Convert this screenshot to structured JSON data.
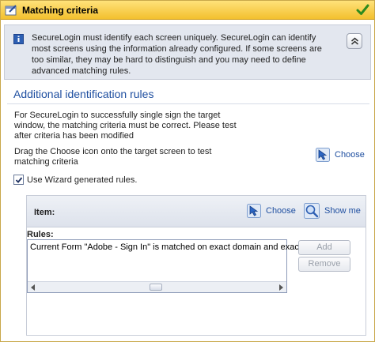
{
  "window": {
    "title": "Matching criteria"
  },
  "info": {
    "message": "SecureLogin must identify each screen uniquely. SecureLogin can identify most screens using the information already configured. If some screens are too similar, they may be hard to distinguish and you may need to define advanced matching rules."
  },
  "section": {
    "title": "Additional identification rules",
    "intro": "For SecureLogin to successfully single sign the target window, the matching criteria must be correct. Please test after criteria has been modified",
    "drag_hint": "Drag the Choose icon onto the target screen to test matching criteria",
    "choose_label": "Choose"
  },
  "wizard": {
    "label": "Use Wizard generated rules.",
    "checked": true
  },
  "item_bar": {
    "label": "Item:",
    "choose_label": "Choose",
    "showme_label": "Show me"
  },
  "rules": {
    "label": "Rules:",
    "lines": [
      "Current Form \"Adobe - Sign In\" is matched on exact domain and exact name"
    ],
    "add_label": "Add",
    "remove_label": "Remove"
  },
  "colors": {
    "accent": "#1f4fa0",
    "titlebar": "#f3c02e",
    "info_band": "#e3e7ef"
  },
  "icons": [
    "window-icon",
    "checkmark-icon",
    "info-icon",
    "collapse-icon",
    "choose-icon",
    "show-me-icon"
  ]
}
